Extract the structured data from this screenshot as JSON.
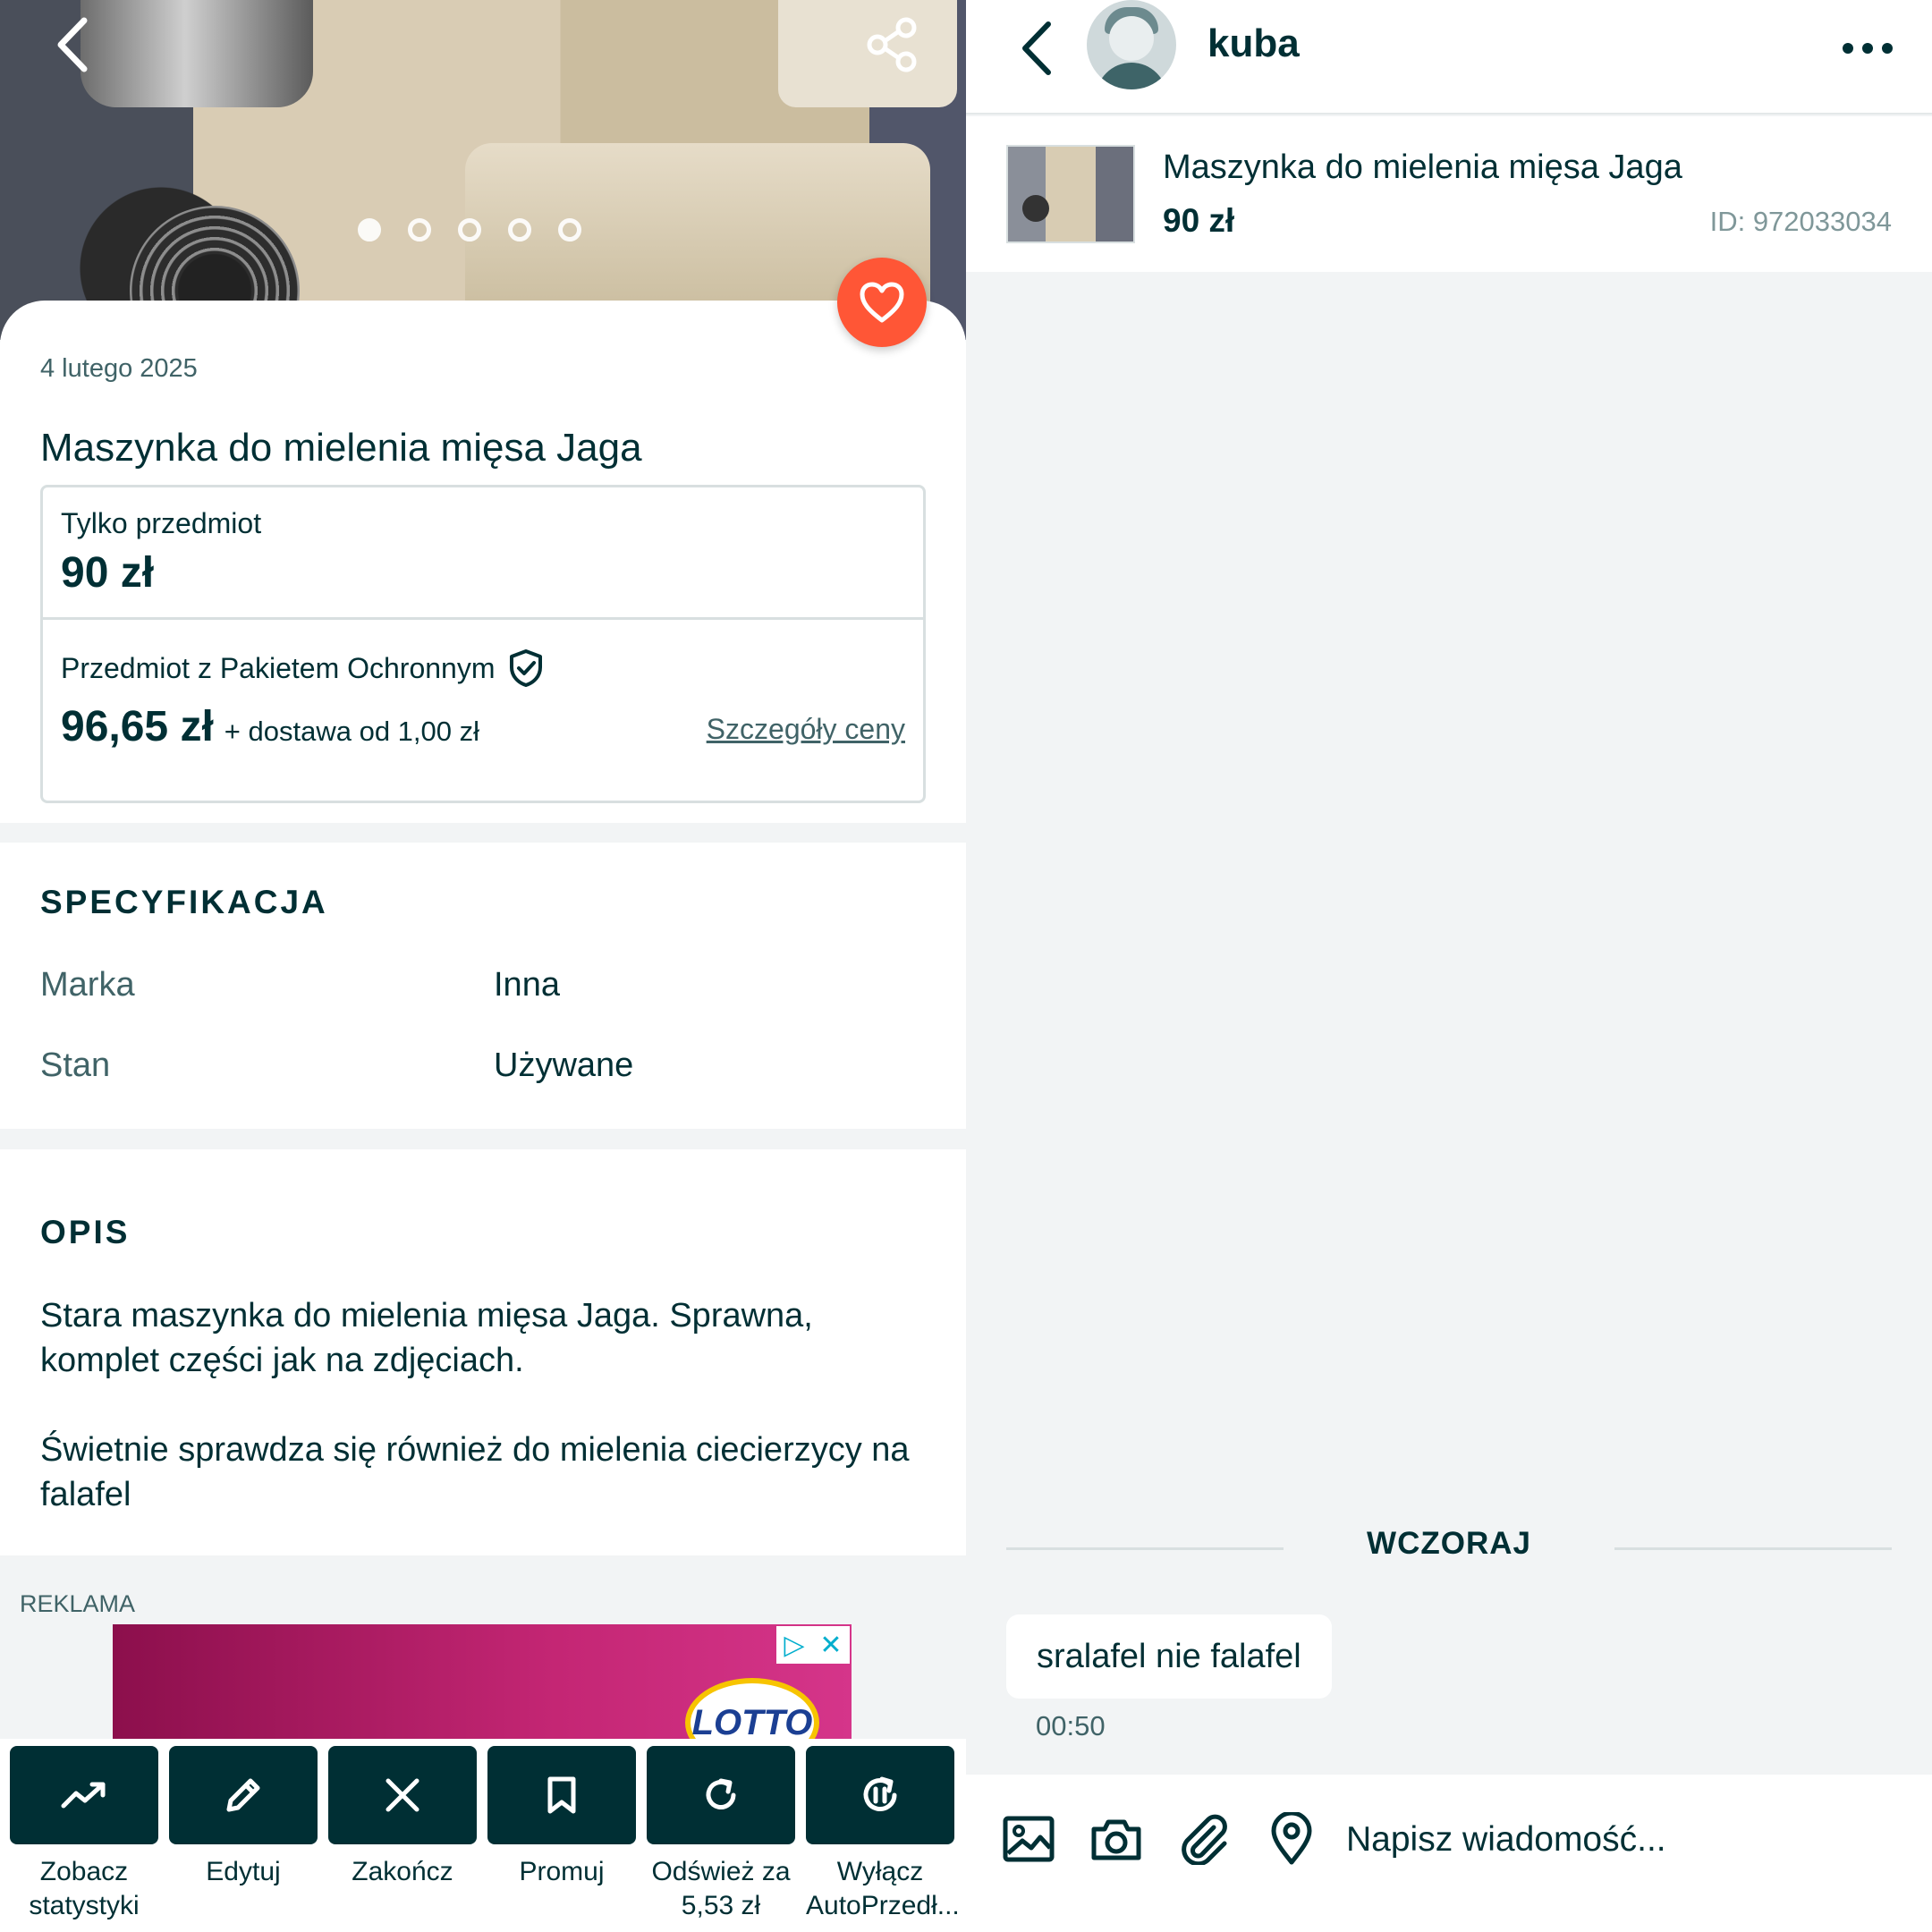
{
  "listing": {
    "photo_pages": 5,
    "photo_active_index": 0,
    "date": "4 lutego 2025",
    "title": "Maszynka do mielenia mięsa Jaga",
    "price_item_only_label": "Tylko przedmiot",
    "price_item_only": "90 zł",
    "price_protected_label": "Przedmiot z Pakietem Ochronnym",
    "price_protected": "96,65 zł",
    "shipping": "+ dostawa od 1,00 zł",
    "price_details_link": "Szczegóły ceny",
    "spec_heading": "SPECYFIKACJA",
    "spec": [
      {
        "key": "Marka",
        "value": "Inna"
      },
      {
        "key": "Stan",
        "value": "Używane"
      }
    ],
    "desc_heading": "OPIS",
    "description": [
      "Stara maszynka do mielenia mięsa Jaga. Sprawna, komplet części jak na zdjęciach.",
      "Świetnie sprawdza się również do mielenia ciecierzycy na falafel"
    ],
    "ad_label": "REKLAMA",
    "ad_logo_text": "LOTTO",
    "actions": [
      {
        "label": "Zobacz statystyki",
        "icon": "trending-up-icon"
      },
      {
        "label": "Edytuj",
        "icon": "pencil-icon"
      },
      {
        "label": "Zakończ",
        "icon": "close-icon"
      },
      {
        "label": "Promuj",
        "icon": "bookmark-icon"
      },
      {
        "label": "Odśwież za 5,53 zł",
        "icon": "refresh-icon"
      },
      {
        "label": "Wyłącz AutoPrzedł...",
        "icon": "pause-refresh-icon"
      }
    ]
  },
  "chat": {
    "username": "kuba",
    "item_title": "Maszynka do mielenia mięsa Jaga",
    "item_price": "90 zł",
    "item_id": "ID: 972033034",
    "day_separator": "WCZORAJ",
    "messages": [
      {
        "text": "sralafel nie falafel",
        "time": "00:50"
      }
    ],
    "composer_placeholder": "Napisz wiadomość..."
  },
  "colors": {
    "brand_dark": "#002f34",
    "favorite": "#ff5636",
    "muted": "#406367",
    "background": "#f2f4f5"
  }
}
